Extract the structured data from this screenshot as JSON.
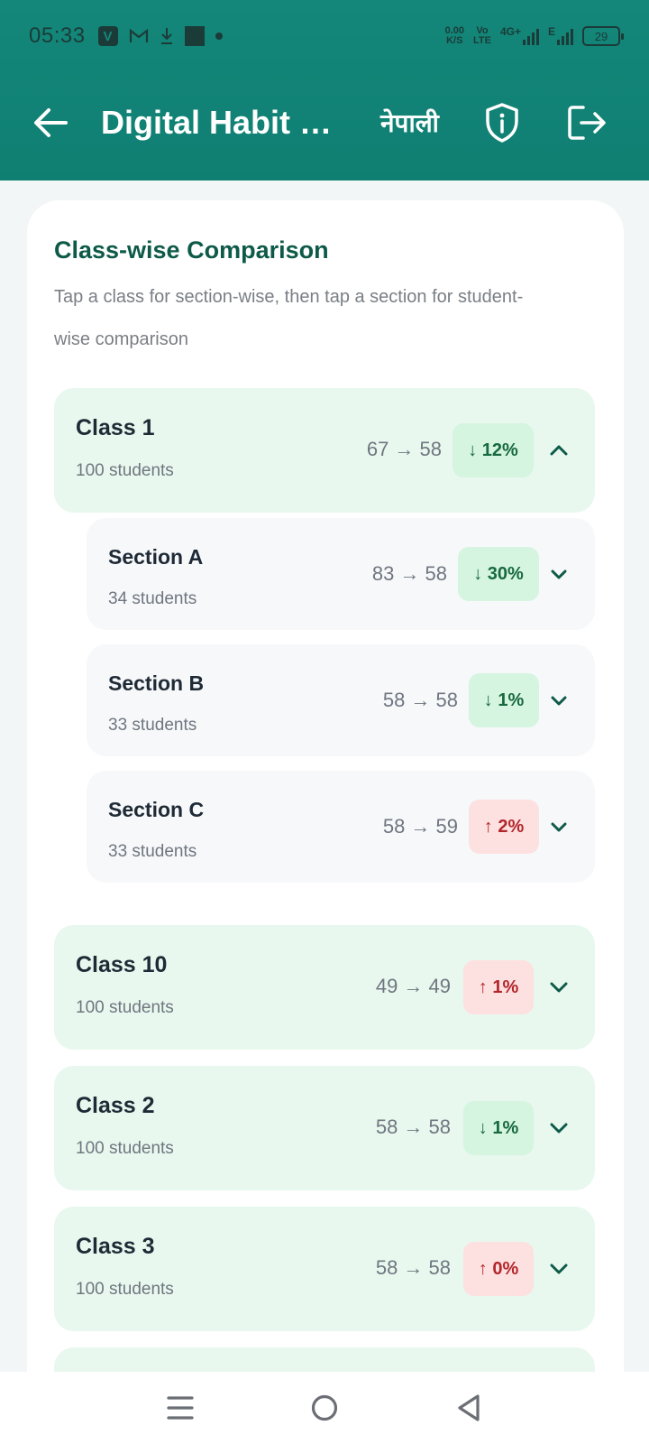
{
  "status_bar": {
    "time": "05:33",
    "net_speed_value": "0.00",
    "net_speed_unit": "K/S",
    "volte_top": "Vo",
    "volte_bottom": "LTE",
    "network": "4G+",
    "network2": "E",
    "battery": "29"
  },
  "app_bar": {
    "title": "Digital Habit Co...",
    "language": "नेपाली"
  },
  "comparison": {
    "title": "Class-wise Comparison",
    "subtitle": "Tap a class for section-wise, then tap a section for student-wise comparison",
    "classes": [
      {
        "name": "Class 1",
        "students": "100 students",
        "scores": "67 → 58",
        "change": "↓ 12%",
        "direction": "down",
        "expanded": true,
        "sections": [
          {
            "name": "Section A",
            "students": "34 students",
            "scores": "83 → 58",
            "change": "↓ 30%",
            "direction": "down"
          },
          {
            "name": "Section B",
            "students": "33 students",
            "scores": "58 → 58",
            "change": "↓ 1%",
            "direction": "down"
          },
          {
            "name": "Section C",
            "students": "33 students",
            "scores": "58 → 59",
            "change": "↑ 2%",
            "direction": "up"
          }
        ]
      },
      {
        "name": "Class 10",
        "students": "100 students",
        "scores": "49 → 49",
        "change": "↑ 1%",
        "direction": "up",
        "expanded": false
      },
      {
        "name": "Class 2",
        "students": "100 students",
        "scores": "58 → 58",
        "change": "↓ 1%",
        "direction": "down",
        "expanded": false
      },
      {
        "name": "Class 3",
        "students": "100 students",
        "scores": "58 → 58",
        "change": "↑ 0%",
        "direction": "up",
        "expanded": false
      }
    ]
  },
  "colors": {
    "primary": "#0f7f72",
    "heading": "#0d5a48",
    "down_bg": "#d5f5e0",
    "down_text": "#17693f",
    "up_bg": "#fde0e0",
    "up_text": "#b3262b"
  }
}
